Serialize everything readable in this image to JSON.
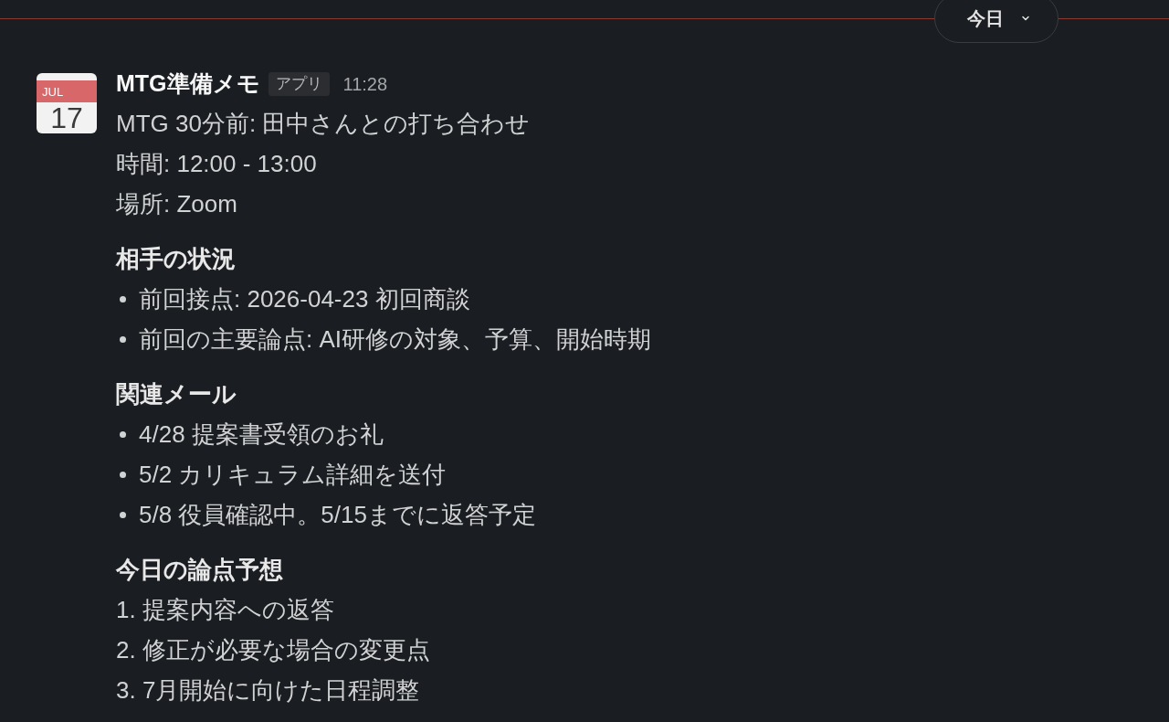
{
  "date_divider": {
    "label": "今日"
  },
  "message": {
    "avatar": {
      "month": "JUL",
      "day": "17"
    },
    "sender": "MTG準備メモ",
    "badge": "アプリ",
    "time": "11:28",
    "lines": [
      "MTG 30分前: 田中さんとの打ち合わせ",
      "時間: 12:00 - 13:00",
      "場所: Zoom"
    ],
    "sections": [
      {
        "heading": "相手の状況",
        "kind": "bulleted",
        "items": [
          "前回接点: 2026-04-23 初回商談",
          "前回の主要論点: AI研修の対象、予算、開始時期"
        ]
      },
      {
        "heading": "関連メール",
        "kind": "bulleted",
        "items": [
          "4/28 提案書受領のお礼",
          "5/2 カリキュラム詳細を送付",
          "5/8 役員確認中。5/15までに返答予定"
        ]
      },
      {
        "heading": "今日の論点予想",
        "kind": "numbered",
        "items": [
          "1. 提案内容への返答",
          "2. 修正が必要な場合の変更点",
          "3. 7月開始に向けた日程調整"
        ]
      }
    ]
  }
}
